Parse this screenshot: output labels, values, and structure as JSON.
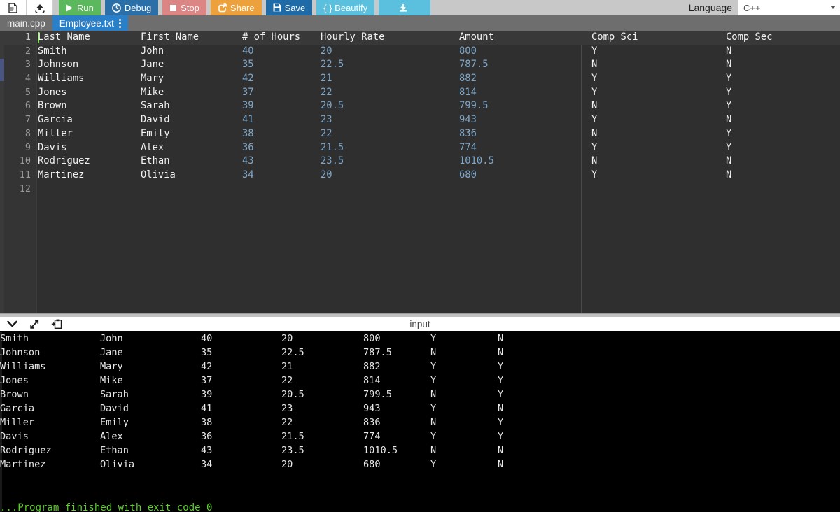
{
  "toolbar": {
    "file_icon": "file-icon",
    "upload_icon": "upload-icon",
    "run_label": "Run",
    "debug_label": "Debug",
    "stop_label": "Stop",
    "share_label": "Share",
    "save_label": "Save",
    "beautify_label": "{ } Beautify",
    "download_label": "",
    "language_label": "Language",
    "language_value": "C++"
  },
  "tabs": [
    {
      "label": "main.cpp",
      "active": false,
      "kebab": false
    },
    {
      "label": "Employee.txt",
      "active": true,
      "kebab": true
    }
  ],
  "editor": {
    "line_numbers": [
      "1",
      "2",
      "3",
      "4",
      "5",
      "6",
      "7",
      "8",
      "9",
      "10",
      "11",
      "12"
    ],
    "active_line": 1,
    "headers": {
      "last": "Last Name",
      "first": "First Name",
      "hours": "# of Hours",
      "rate": "Hourly Rate",
      "amount": "Amount",
      "comp_sci": "Comp Sci",
      "comp_sec": "Comp Sec"
    },
    "rows": [
      {
        "last": "Smith",
        "first": "John",
        "hours": "40",
        "rate": "20",
        "amount": "800",
        "sci": "Y",
        "sec": "N"
      },
      {
        "last": "Johnson",
        "first": "Jane",
        "hours": "35",
        "rate": "22.5",
        "amount": "787.5",
        "sci": "N",
        "sec": "N"
      },
      {
        "last": "Williams",
        "first": "Mary",
        "hours": "42",
        "rate": "21",
        "amount": "882",
        "sci": "Y",
        "sec": "Y"
      },
      {
        "last": "Jones",
        "first": "Mike",
        "hours": "37",
        "rate": "22",
        "amount": "814",
        "sci": "Y",
        "sec": "Y"
      },
      {
        "last": "Brown",
        "first": "Sarah",
        "hours": "39",
        "rate": "20.5",
        "amount": "799.5",
        "sci": "N",
        "sec": "Y"
      },
      {
        "last": "Garcia",
        "first": "David",
        "hours": "41",
        "rate": "23",
        "amount": "943",
        "sci": "Y",
        "sec": "N"
      },
      {
        "last": "Miller",
        "first": "Emily",
        "hours": "38",
        "rate": "22",
        "amount": "836",
        "sci": "N",
        "sec": "Y"
      },
      {
        "last": "Davis",
        "first": "Alex",
        "hours": "36",
        "rate": "21.5",
        "amount": "774",
        "sci": "Y",
        "sec": "Y"
      },
      {
        "last": "Rodriguez",
        "first": "Ethan",
        "hours": "43",
        "rate": "23.5",
        "amount": "1010.5",
        "sci": "N",
        "sec": "N"
      },
      {
        "last": "Martinez",
        "first": "Olivia",
        "hours": "34",
        "rate": "20",
        "amount": "680",
        "sci": "Y",
        "sec": "N"
      }
    ]
  },
  "output": {
    "title": "input",
    "icons": [
      "chevron-down-icon",
      "expand-icon",
      "paste-icon"
    ],
    "rows": [
      {
        "last": "Smith",
        "first": "John",
        "hours": "40",
        "rate": "20",
        "amount": "800",
        "sci": "Y",
        "sec": "N"
      },
      {
        "last": "Johnson",
        "first": "Jane",
        "hours": "35",
        "rate": "22.5",
        "amount": "787.5",
        "sci": "N",
        "sec": "N"
      },
      {
        "last": "Williams",
        "first": "Mary",
        "hours": "42",
        "rate": "21",
        "amount": "882",
        "sci": "Y",
        "sec": "Y"
      },
      {
        "last": "Jones",
        "first": "Mike",
        "hours": "37",
        "rate": "22",
        "amount": "814",
        "sci": "Y",
        "sec": "Y"
      },
      {
        "last": "Brown",
        "first": "Sarah",
        "hours": "39",
        "rate": "20.5",
        "amount": "799.5",
        "sci": "N",
        "sec": "Y"
      },
      {
        "last": "Garcia",
        "first": "David",
        "hours": "41",
        "rate": "23",
        "amount": "943",
        "sci": "Y",
        "sec": "N"
      },
      {
        "last": "Miller",
        "first": "Emily",
        "hours": "38",
        "rate": "22",
        "amount": "836",
        "sci": "N",
        "sec": "Y"
      },
      {
        "last": "Davis",
        "first": "Alex",
        "hours": "36",
        "rate": "21.5",
        "amount": "774",
        "sci": "Y",
        "sec": "Y"
      },
      {
        "last": "Rodriguez",
        "first": "Ethan",
        "hours": "43",
        "rate": "23.5",
        "amount": "1010.5",
        "sci": "N",
        "sec": "N"
      },
      {
        "last": "Martinez",
        "first": "Olivia",
        "hours": "34",
        "rate": "20",
        "amount": "680",
        "sci": "Y",
        "sec": "N"
      }
    ],
    "finish_message": "...Program finished with exit code 0"
  },
  "colors": {
    "toolbar_bg": "#c8c8c8",
    "tabbar_bg": "#6e6e6e",
    "tab_active": "#2a7fc9",
    "editor_bg": "#2f2f2f",
    "console_bg": "#000000",
    "run_green": "#5cb85c",
    "debug_blue": "#2a6fa8",
    "stop_red": "#dc8585",
    "share_orange": "#eda13c",
    "save_blue": "#1e6ba8",
    "beautify_cyan": "#5bc0de",
    "number_blue": "#7fa7c9",
    "exit_green": "#5ed12a",
    "cursor_green": "#7bdc52"
  }
}
